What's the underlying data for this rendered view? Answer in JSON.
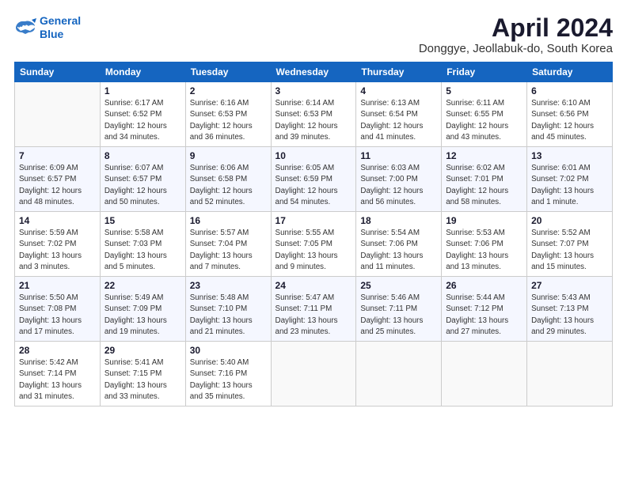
{
  "header": {
    "logo_line1": "General",
    "logo_line2": "Blue",
    "month_title": "April 2024",
    "location": "Donggye, Jeollabuk-do, South Korea"
  },
  "weekdays": [
    "Sunday",
    "Monday",
    "Tuesday",
    "Wednesday",
    "Thursday",
    "Friday",
    "Saturday"
  ],
  "weeks": [
    [
      {
        "day": "",
        "info": ""
      },
      {
        "day": "1",
        "info": "Sunrise: 6:17 AM\nSunset: 6:52 PM\nDaylight: 12 hours\nand 34 minutes."
      },
      {
        "day": "2",
        "info": "Sunrise: 6:16 AM\nSunset: 6:53 PM\nDaylight: 12 hours\nand 36 minutes."
      },
      {
        "day": "3",
        "info": "Sunrise: 6:14 AM\nSunset: 6:53 PM\nDaylight: 12 hours\nand 39 minutes."
      },
      {
        "day": "4",
        "info": "Sunrise: 6:13 AM\nSunset: 6:54 PM\nDaylight: 12 hours\nand 41 minutes."
      },
      {
        "day": "5",
        "info": "Sunrise: 6:11 AM\nSunset: 6:55 PM\nDaylight: 12 hours\nand 43 minutes."
      },
      {
        "day": "6",
        "info": "Sunrise: 6:10 AM\nSunset: 6:56 PM\nDaylight: 12 hours\nand 45 minutes."
      }
    ],
    [
      {
        "day": "7",
        "info": "Sunrise: 6:09 AM\nSunset: 6:57 PM\nDaylight: 12 hours\nand 48 minutes."
      },
      {
        "day": "8",
        "info": "Sunrise: 6:07 AM\nSunset: 6:57 PM\nDaylight: 12 hours\nand 50 minutes."
      },
      {
        "day": "9",
        "info": "Sunrise: 6:06 AM\nSunset: 6:58 PM\nDaylight: 12 hours\nand 52 minutes."
      },
      {
        "day": "10",
        "info": "Sunrise: 6:05 AM\nSunset: 6:59 PM\nDaylight: 12 hours\nand 54 minutes."
      },
      {
        "day": "11",
        "info": "Sunrise: 6:03 AM\nSunset: 7:00 PM\nDaylight: 12 hours\nand 56 minutes."
      },
      {
        "day": "12",
        "info": "Sunrise: 6:02 AM\nSunset: 7:01 PM\nDaylight: 12 hours\nand 58 minutes."
      },
      {
        "day": "13",
        "info": "Sunrise: 6:01 AM\nSunset: 7:02 PM\nDaylight: 13 hours\nand 1 minute."
      }
    ],
    [
      {
        "day": "14",
        "info": "Sunrise: 5:59 AM\nSunset: 7:02 PM\nDaylight: 13 hours\nand 3 minutes."
      },
      {
        "day": "15",
        "info": "Sunrise: 5:58 AM\nSunset: 7:03 PM\nDaylight: 13 hours\nand 5 minutes."
      },
      {
        "day": "16",
        "info": "Sunrise: 5:57 AM\nSunset: 7:04 PM\nDaylight: 13 hours\nand 7 minutes."
      },
      {
        "day": "17",
        "info": "Sunrise: 5:55 AM\nSunset: 7:05 PM\nDaylight: 13 hours\nand 9 minutes."
      },
      {
        "day": "18",
        "info": "Sunrise: 5:54 AM\nSunset: 7:06 PM\nDaylight: 13 hours\nand 11 minutes."
      },
      {
        "day": "19",
        "info": "Sunrise: 5:53 AM\nSunset: 7:06 PM\nDaylight: 13 hours\nand 13 minutes."
      },
      {
        "day": "20",
        "info": "Sunrise: 5:52 AM\nSunset: 7:07 PM\nDaylight: 13 hours\nand 15 minutes."
      }
    ],
    [
      {
        "day": "21",
        "info": "Sunrise: 5:50 AM\nSunset: 7:08 PM\nDaylight: 13 hours\nand 17 minutes."
      },
      {
        "day": "22",
        "info": "Sunrise: 5:49 AM\nSunset: 7:09 PM\nDaylight: 13 hours\nand 19 minutes."
      },
      {
        "day": "23",
        "info": "Sunrise: 5:48 AM\nSunset: 7:10 PM\nDaylight: 13 hours\nand 21 minutes."
      },
      {
        "day": "24",
        "info": "Sunrise: 5:47 AM\nSunset: 7:11 PM\nDaylight: 13 hours\nand 23 minutes."
      },
      {
        "day": "25",
        "info": "Sunrise: 5:46 AM\nSunset: 7:11 PM\nDaylight: 13 hours\nand 25 minutes."
      },
      {
        "day": "26",
        "info": "Sunrise: 5:44 AM\nSunset: 7:12 PM\nDaylight: 13 hours\nand 27 minutes."
      },
      {
        "day": "27",
        "info": "Sunrise: 5:43 AM\nSunset: 7:13 PM\nDaylight: 13 hours\nand 29 minutes."
      }
    ],
    [
      {
        "day": "28",
        "info": "Sunrise: 5:42 AM\nSunset: 7:14 PM\nDaylight: 13 hours\nand 31 minutes."
      },
      {
        "day": "29",
        "info": "Sunrise: 5:41 AM\nSunset: 7:15 PM\nDaylight: 13 hours\nand 33 minutes."
      },
      {
        "day": "30",
        "info": "Sunrise: 5:40 AM\nSunset: 7:16 PM\nDaylight: 13 hours\nand 35 minutes."
      },
      {
        "day": "",
        "info": ""
      },
      {
        "day": "",
        "info": ""
      },
      {
        "day": "",
        "info": ""
      },
      {
        "day": "",
        "info": ""
      }
    ]
  ]
}
